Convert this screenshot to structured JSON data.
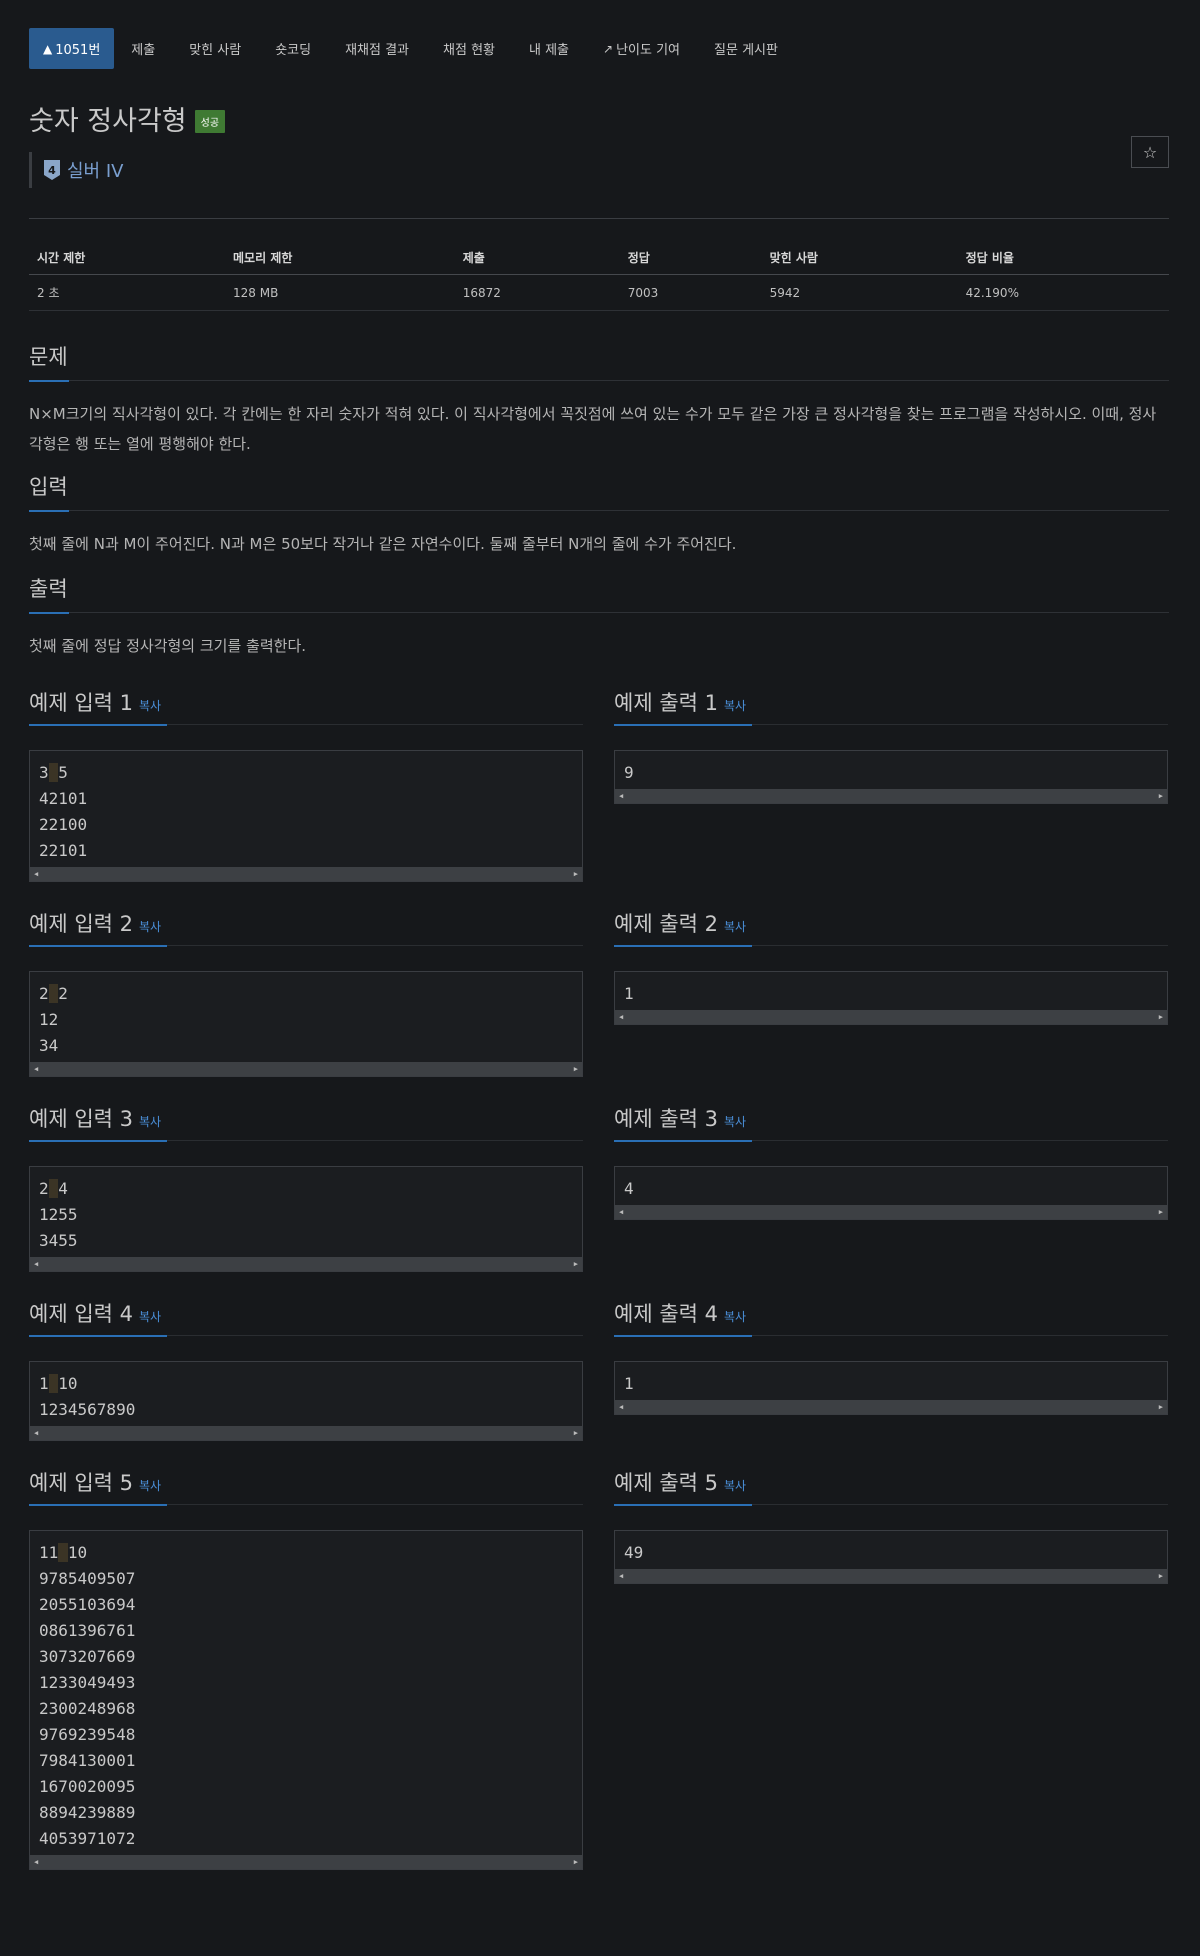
{
  "tabs": [
    {
      "label": "1051번",
      "active": true,
      "icon": "tier-icon"
    },
    {
      "label": "제출"
    },
    {
      "label": "맞힌 사람"
    },
    {
      "label": "숏코딩"
    },
    {
      "label": "재채점 결과"
    },
    {
      "label": "채점 현황"
    },
    {
      "label": "내 제출"
    },
    {
      "label": "난이도 기여",
      "icon": "external-link-icon"
    },
    {
      "label": "질문 게시판"
    }
  ],
  "problem": {
    "title": "숫자 정사각형",
    "badge": "성공",
    "tier_number": "4",
    "tier_name": "실버 IV",
    "star_icon": "☆"
  },
  "stats": {
    "headers": [
      "시간 제한",
      "메모리 제한",
      "제출",
      "정답",
      "맞힌 사람",
      "정답 비율"
    ],
    "values": [
      "2 초",
      "128 MB",
      "16872",
      "7003",
      "5942",
      "42.190%"
    ]
  },
  "sections": {
    "problem_title": "문제",
    "problem_text": "N×M크기의 직사각형이 있다. 각 칸에는 한 자리 숫자가 적혀 있다. 이 직사각형에서 꼭짓점에 쓰여 있는 수가 모두 같은 가장 큰 정사각형을 찾는 프로그램을 작성하시오. 이때, 정사각형은 행 또는 열에 평행해야 한다.",
    "input_title": "입력",
    "input_text": "첫째 줄에 N과 M이 주어진다. N과 M은 50보다 작거나 같은 자연수이다. 둘째 줄부터 N개의 줄에 수가 주어진다.",
    "output_title": "출력",
    "output_text": "첫째 줄에 정답 정사각형의 크기를 출력한다."
  },
  "copy_label": "복사",
  "samples": [
    {
      "in_title": "예제 입력 1",
      "out_title": "예제 출력 1",
      "input": [
        "3 5",
        "42101",
        "22100",
        "22101"
      ],
      "output": [
        "9"
      ]
    },
    {
      "in_title": "예제 입력 2",
      "out_title": "예제 출력 2",
      "input": [
        "2 2",
        "12",
        "34"
      ],
      "output": [
        "1"
      ]
    },
    {
      "in_title": "예제 입력 3",
      "out_title": "예제 출력 3",
      "input": [
        "2 4",
        "1255",
        "3455"
      ],
      "output": [
        "4"
      ]
    },
    {
      "in_title": "예제 입력 4",
      "out_title": "예제 출력 4",
      "input": [
        "1 10",
        "1234567890"
      ],
      "output": [
        "1"
      ]
    },
    {
      "in_title": "예제 입력 5",
      "out_title": "예제 출력 5",
      "input": [
        "11 10",
        "9785409507",
        "2055103694",
        "0861396761",
        "3073207669",
        "1233049493",
        "2300248968",
        "9769239548",
        "7984130001",
        "1670020095",
        "8894239889",
        "4053971072"
      ],
      "output": [
        "49"
      ]
    }
  ]
}
